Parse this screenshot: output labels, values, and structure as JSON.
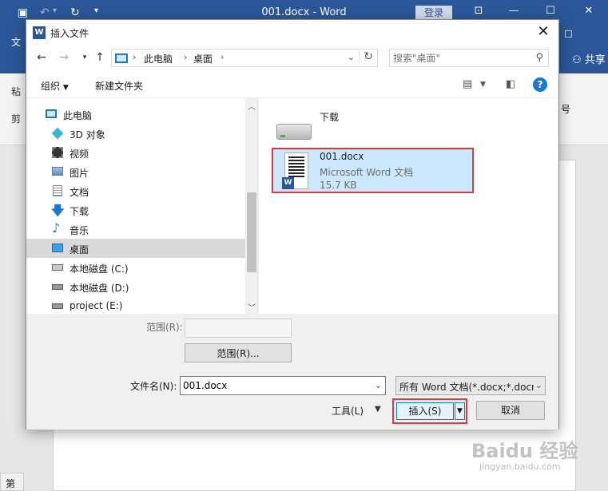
{
  "word": {
    "title": "001.docx  -  Word",
    "login": "登录",
    "share": "共享",
    "ribbon_left": [
      "文",
      "粘",
      "剪"
    ],
    "ribbon_right": "号",
    "status": "第"
  },
  "dialog": {
    "title": "插入文件",
    "address": {
      "crumbs": [
        "此电脑",
        "桌面"
      ]
    },
    "search_placeholder": "搜索\"桌面\"",
    "toolbar": {
      "organize": "组织",
      "new_folder": "新建文件夹"
    },
    "tree": [
      {
        "label": "此电脑",
        "icon": "pc-icon"
      },
      {
        "label": "3D 对象",
        "icon": "3d-objects-icon"
      },
      {
        "label": "视频",
        "icon": "video-icon"
      },
      {
        "label": "图片",
        "icon": "pictures-icon"
      },
      {
        "label": "文档",
        "icon": "documents-icon"
      },
      {
        "label": "下载",
        "icon": "download-icon"
      },
      {
        "label": "音乐",
        "icon": "music-icon"
      },
      {
        "label": "桌面",
        "icon": "desktop-icon",
        "selected": true
      },
      {
        "label": "本地磁盘 (C:)",
        "icon": "system-drive-icon"
      },
      {
        "label": "本地磁盘 (D:)",
        "icon": "drive-icon"
      },
      {
        "label": "project (E:)",
        "icon": "drive-icon"
      }
    ],
    "files": {
      "folder": {
        "name": "下载"
      },
      "doc": {
        "name": "001.docx",
        "type": "Microsoft Word 文档",
        "size": "15.7 KB"
      }
    },
    "range_label": "范围(R):",
    "range_button": "范围(R)...",
    "filename_label": "文件名(N):",
    "filename_value": "001.docx",
    "filter_value": "所有 Word 文档(*.docx;*.docm",
    "tools_label": "工具(L)",
    "insert_label": "插入(S)",
    "cancel_label": "取消"
  },
  "watermark": {
    "main": "Baidu 经验",
    "sub": "jingyan.baidu.com"
  },
  "colors": {
    "word_blue": "#2b579a",
    "selection": "#cce8ff",
    "highlight_border": "#e0393f"
  }
}
